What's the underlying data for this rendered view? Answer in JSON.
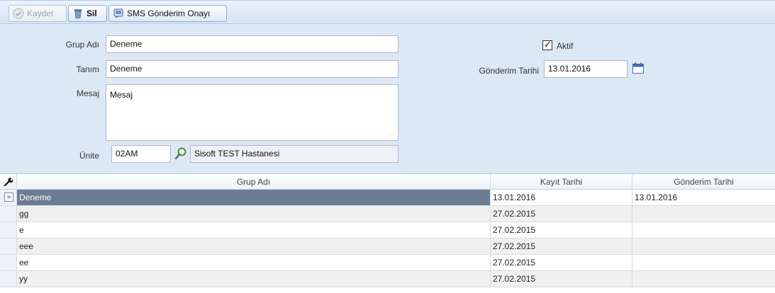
{
  "toolbar": {
    "save_label": "Kaydet",
    "delete_label": "Sil",
    "sms_label": "SMS Gönderim Onayı"
  },
  "form": {
    "group_name_label": "Grup Adı",
    "group_name_value": "Deneme",
    "definition_label": "Tanım",
    "definition_value": "Deneme",
    "message_label": "Mesaj",
    "message_value": "Mesaj",
    "unit_label": "Ünite",
    "unit_code": "02AM",
    "unit_name": "Sisoft TEST Hastanesi",
    "active_label": "Aktif",
    "active_checked": true,
    "send_date_label": "Gönderim Tarihi",
    "send_date_value": "13.01.2016"
  },
  "grid": {
    "columns": [
      "Grup Adı",
      "Kayıt Tarihi",
      "Gönderim Tarihi"
    ],
    "rows": [
      {
        "name": "Deneme",
        "kayit": "13.01.2016",
        "gonderim": "13.01.2016",
        "selected": true
      },
      {
        "name": "gg",
        "kayit": "27.02.2015",
        "gonderim": ""
      },
      {
        "name": "e",
        "kayit": "27.02.2015",
        "gonderim": ""
      },
      {
        "name": "eee",
        "kayit": "27.02.2015",
        "gonderim": ""
      },
      {
        "name": "ee",
        "kayit": "27.02.2015",
        "gonderim": ""
      },
      {
        "name": "yy",
        "kayit": "27.02.2015",
        "gonderim": ""
      }
    ]
  }
}
